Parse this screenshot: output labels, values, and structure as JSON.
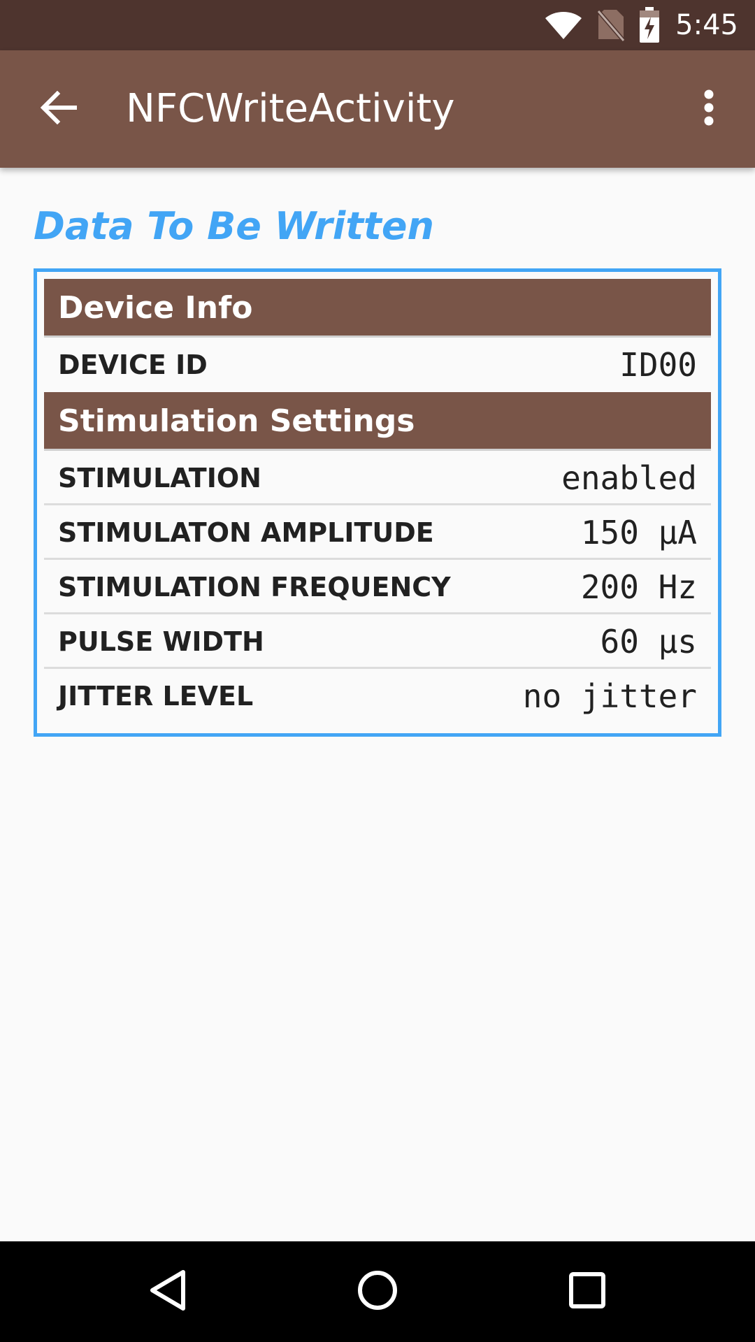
{
  "status_bar": {
    "time": "5:45",
    "icons": [
      "wifi-icon",
      "no-sim-icon",
      "battery-charging-icon"
    ]
  },
  "app_bar": {
    "title": "NFCWriteActivity",
    "back_icon": "arrow-back-icon",
    "overflow_icon": "more-vert-icon"
  },
  "content": {
    "section_title": "Data To Be Written",
    "groups": [
      {
        "header": "Device Info",
        "rows": [
          {
            "label": "DEVICE ID",
            "value": "ID00"
          }
        ]
      },
      {
        "header": "Stimulation Settings",
        "rows": [
          {
            "label": "STIMULATION",
            "value": "enabled"
          },
          {
            "label": "STIMULATON AMPLITUDE",
            "value": "150 µA"
          },
          {
            "label": "STIMULATION FREQUENCY",
            "value": "200 Hz"
          },
          {
            "label": "PULSE WIDTH",
            "value": "60 µs"
          },
          {
            "label": "JITTER LEVEL",
            "value": "no jitter"
          }
        ]
      }
    ]
  },
  "nav_bar": {
    "back_icon": "nav-back-icon",
    "home_icon": "nav-home-icon",
    "recents_icon": "nav-recents-icon"
  },
  "colors": {
    "status_bar": "#4e342e",
    "app_bar": "#795548",
    "accent": "#42a5f5",
    "group_header": "#795548",
    "background": "#fafafa"
  }
}
